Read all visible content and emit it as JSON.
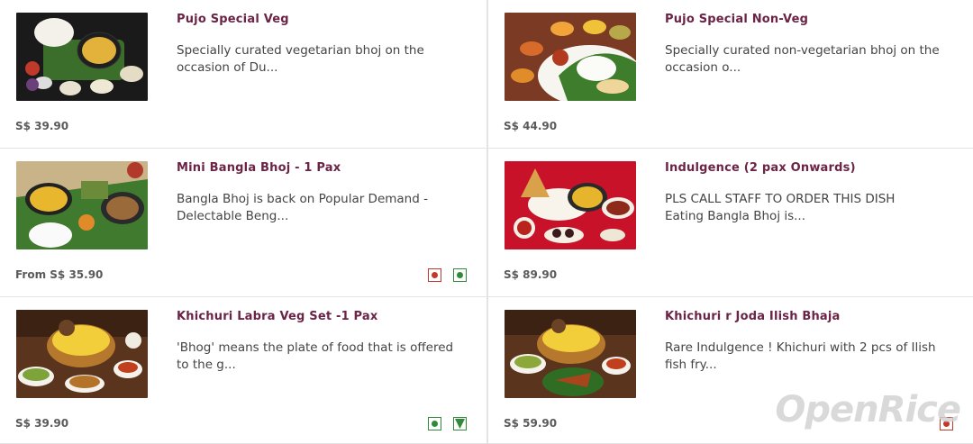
{
  "items": [
    {
      "title": "Pujo Special Veg",
      "desc": "Specially curated vegetarian bhoj on the occasion of Du...",
      "price": "S$ 39.90",
      "tags": []
    },
    {
      "title": "Pujo Special Non-Veg",
      "desc": "Specially curated non-vegetarian bhoj on the occasion o...",
      "price": "S$ 44.90",
      "tags": []
    },
    {
      "title": "Mini Bangla Bhoj - 1 Pax",
      "desc": "Bangla Bhoj is back on Popular Demand - Delectable Beng...",
      "price": "From S$ 35.90",
      "tags": [
        "non-veg",
        "veg"
      ]
    },
    {
      "title": "Indulgence (2 pax Onwards)",
      "desc_line1": "PLS CALL STAFF TO ORDER THIS DISH",
      "desc_line2": "Eating Bangla Bhoj is...",
      "price": "S$ 89.90",
      "tags": []
    },
    {
      "title": "Khichuri Labra Veg Set -1 Pax",
      "desc": "'Bhog' means the plate of food that is offered to the g...",
      "price": "S$ 39.90",
      "tags": [
        "veg",
        "vegan"
      ]
    },
    {
      "title": "Khichuri r Joda Ilish Bhaja",
      "desc": "Rare Indulgence ! Khichuri with 2 pcs of Ilish fish fry...",
      "price": "S$ 59.90",
      "tags": [
        "non-veg"
      ]
    }
  ],
  "watermark": "OpenRice",
  "colors": {
    "title": "#6b2346",
    "nonveg": "#c0392b",
    "veg": "#2f8a3a"
  }
}
